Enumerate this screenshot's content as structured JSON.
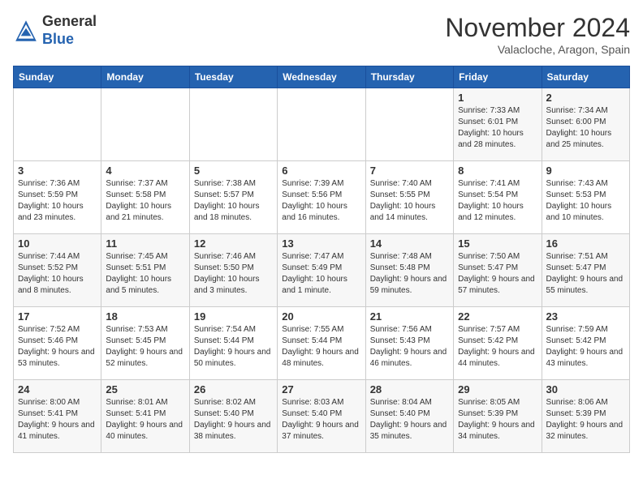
{
  "header": {
    "logo_general": "General",
    "logo_blue": "Blue",
    "month_title": "November 2024",
    "location": "Valacloche, Aragon, Spain"
  },
  "weekdays": [
    "Sunday",
    "Monday",
    "Tuesday",
    "Wednesday",
    "Thursday",
    "Friday",
    "Saturday"
  ],
  "weeks": [
    [
      {
        "day": "",
        "info": ""
      },
      {
        "day": "",
        "info": ""
      },
      {
        "day": "",
        "info": ""
      },
      {
        "day": "",
        "info": ""
      },
      {
        "day": "",
        "info": ""
      },
      {
        "day": "1",
        "info": "Sunrise: 7:33 AM\nSunset: 6:01 PM\nDaylight: 10 hours and 28 minutes."
      },
      {
        "day": "2",
        "info": "Sunrise: 7:34 AM\nSunset: 6:00 PM\nDaylight: 10 hours and 25 minutes."
      }
    ],
    [
      {
        "day": "3",
        "info": "Sunrise: 7:36 AM\nSunset: 5:59 PM\nDaylight: 10 hours and 23 minutes."
      },
      {
        "day": "4",
        "info": "Sunrise: 7:37 AM\nSunset: 5:58 PM\nDaylight: 10 hours and 21 minutes."
      },
      {
        "day": "5",
        "info": "Sunrise: 7:38 AM\nSunset: 5:57 PM\nDaylight: 10 hours and 18 minutes."
      },
      {
        "day": "6",
        "info": "Sunrise: 7:39 AM\nSunset: 5:56 PM\nDaylight: 10 hours and 16 minutes."
      },
      {
        "day": "7",
        "info": "Sunrise: 7:40 AM\nSunset: 5:55 PM\nDaylight: 10 hours and 14 minutes."
      },
      {
        "day": "8",
        "info": "Sunrise: 7:41 AM\nSunset: 5:54 PM\nDaylight: 10 hours and 12 minutes."
      },
      {
        "day": "9",
        "info": "Sunrise: 7:43 AM\nSunset: 5:53 PM\nDaylight: 10 hours and 10 minutes."
      }
    ],
    [
      {
        "day": "10",
        "info": "Sunrise: 7:44 AM\nSunset: 5:52 PM\nDaylight: 10 hours and 8 minutes."
      },
      {
        "day": "11",
        "info": "Sunrise: 7:45 AM\nSunset: 5:51 PM\nDaylight: 10 hours and 5 minutes."
      },
      {
        "day": "12",
        "info": "Sunrise: 7:46 AM\nSunset: 5:50 PM\nDaylight: 10 hours and 3 minutes."
      },
      {
        "day": "13",
        "info": "Sunrise: 7:47 AM\nSunset: 5:49 PM\nDaylight: 10 hours and 1 minute."
      },
      {
        "day": "14",
        "info": "Sunrise: 7:48 AM\nSunset: 5:48 PM\nDaylight: 9 hours and 59 minutes."
      },
      {
        "day": "15",
        "info": "Sunrise: 7:50 AM\nSunset: 5:47 PM\nDaylight: 9 hours and 57 minutes."
      },
      {
        "day": "16",
        "info": "Sunrise: 7:51 AM\nSunset: 5:47 PM\nDaylight: 9 hours and 55 minutes."
      }
    ],
    [
      {
        "day": "17",
        "info": "Sunrise: 7:52 AM\nSunset: 5:46 PM\nDaylight: 9 hours and 53 minutes."
      },
      {
        "day": "18",
        "info": "Sunrise: 7:53 AM\nSunset: 5:45 PM\nDaylight: 9 hours and 52 minutes."
      },
      {
        "day": "19",
        "info": "Sunrise: 7:54 AM\nSunset: 5:44 PM\nDaylight: 9 hours and 50 minutes."
      },
      {
        "day": "20",
        "info": "Sunrise: 7:55 AM\nSunset: 5:44 PM\nDaylight: 9 hours and 48 minutes."
      },
      {
        "day": "21",
        "info": "Sunrise: 7:56 AM\nSunset: 5:43 PM\nDaylight: 9 hours and 46 minutes."
      },
      {
        "day": "22",
        "info": "Sunrise: 7:57 AM\nSunset: 5:42 PM\nDaylight: 9 hours and 44 minutes."
      },
      {
        "day": "23",
        "info": "Sunrise: 7:59 AM\nSunset: 5:42 PM\nDaylight: 9 hours and 43 minutes."
      }
    ],
    [
      {
        "day": "24",
        "info": "Sunrise: 8:00 AM\nSunset: 5:41 PM\nDaylight: 9 hours and 41 minutes."
      },
      {
        "day": "25",
        "info": "Sunrise: 8:01 AM\nSunset: 5:41 PM\nDaylight: 9 hours and 40 minutes."
      },
      {
        "day": "26",
        "info": "Sunrise: 8:02 AM\nSunset: 5:40 PM\nDaylight: 9 hours and 38 minutes."
      },
      {
        "day": "27",
        "info": "Sunrise: 8:03 AM\nSunset: 5:40 PM\nDaylight: 9 hours and 37 minutes."
      },
      {
        "day": "28",
        "info": "Sunrise: 8:04 AM\nSunset: 5:40 PM\nDaylight: 9 hours and 35 minutes."
      },
      {
        "day": "29",
        "info": "Sunrise: 8:05 AM\nSunset: 5:39 PM\nDaylight: 9 hours and 34 minutes."
      },
      {
        "day": "30",
        "info": "Sunrise: 8:06 AM\nSunset: 5:39 PM\nDaylight: 9 hours and 32 minutes."
      }
    ]
  ]
}
